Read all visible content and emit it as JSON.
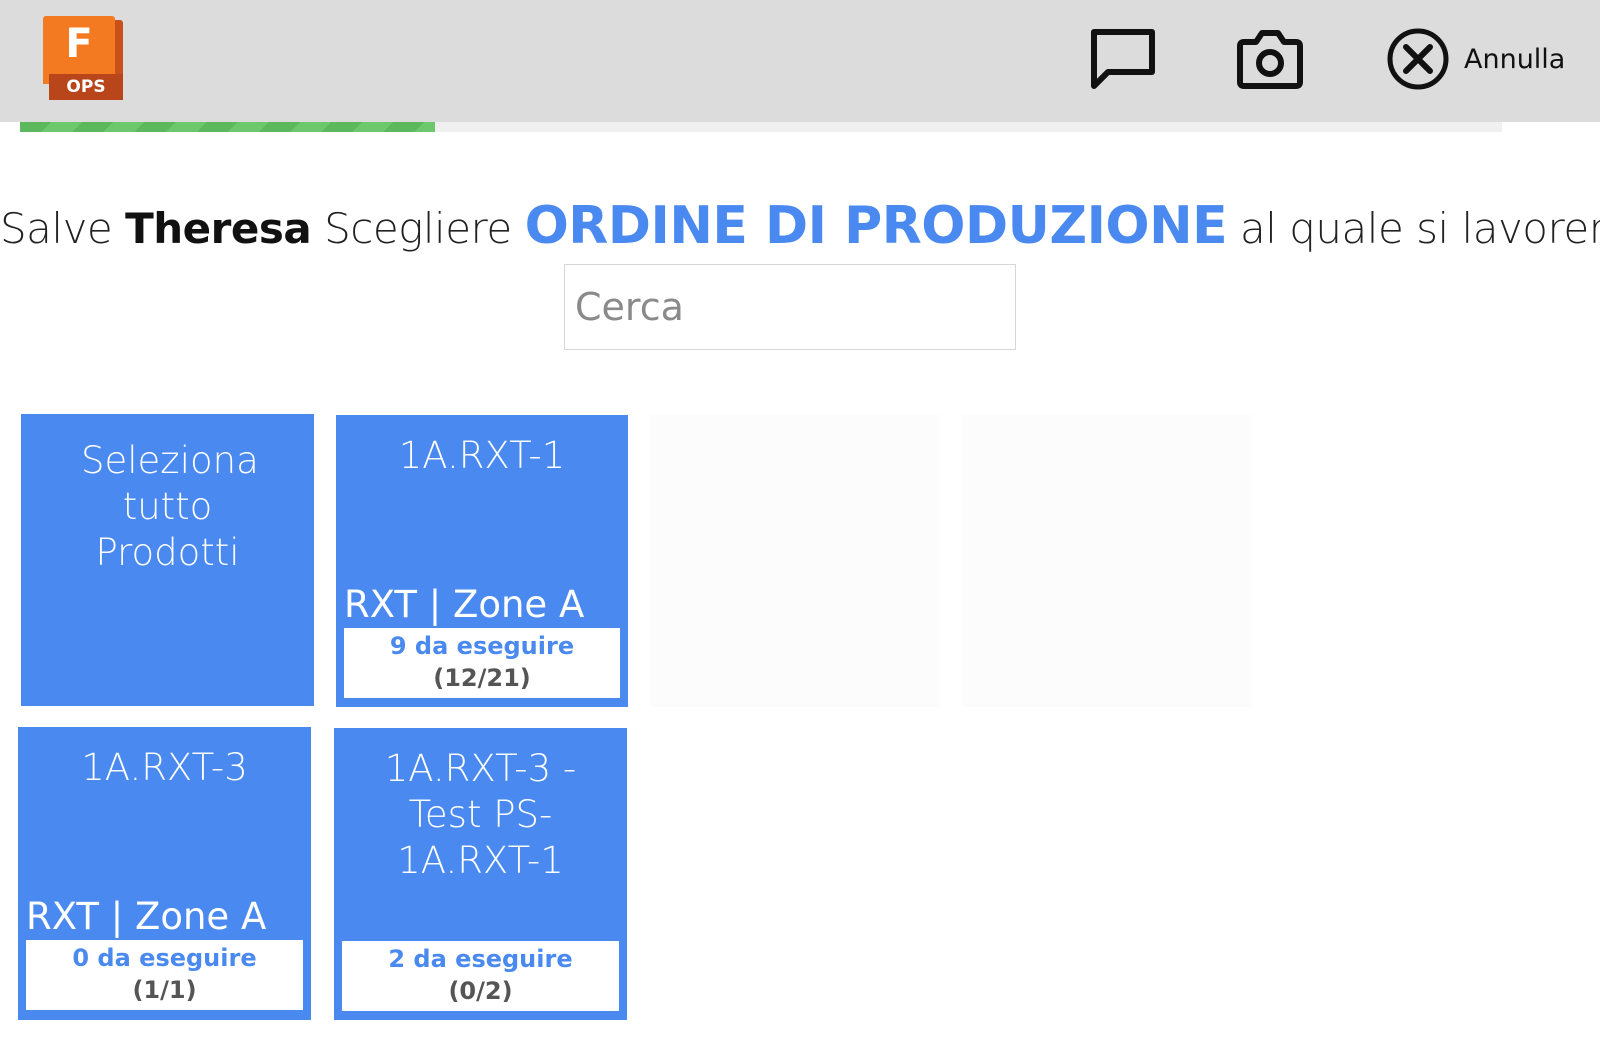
{
  "header": {
    "logo": {
      "letter": "F",
      "tag": "OPS"
    },
    "comment_icon": "comment-icon",
    "camera_icon": "camera-icon",
    "cancel_icon": "close-circle-icon",
    "cancel_label": "Annulla"
  },
  "progress": {
    "fraction": 0.28,
    "color": "#5bb85c"
  },
  "greeting": {
    "prefix": "Salve",
    "name": "Theresa",
    "middle": "Scegliere",
    "highlight": "ORDINE DI PRODUZIONE",
    "suffix": "al quale si lavorerà :"
  },
  "search": {
    "placeholder": "Cerca",
    "value": ""
  },
  "tiles": [
    {
      "title": "Seleziona tutto Prodotti"
    },
    {
      "title": "1A.RXT-1",
      "subtitle": "RXT | Zone A",
      "todo": "9 da eseguire",
      "count": "(12/21)"
    },
    {
      "title": "1A.RXT-3",
      "subtitle": "RXT | Zone A",
      "todo": "0 da eseguire",
      "count": "(1/1)"
    },
    {
      "title": "1A.RXT-3 - Test PS-1A.RXT-1",
      "subtitle": "",
      "todo": "2 da eseguire",
      "count": "(0/2)"
    }
  ],
  "colors": {
    "accent": "#4a8af0",
    "topbar": "#dcdcdc",
    "logo": "#f47a22"
  }
}
